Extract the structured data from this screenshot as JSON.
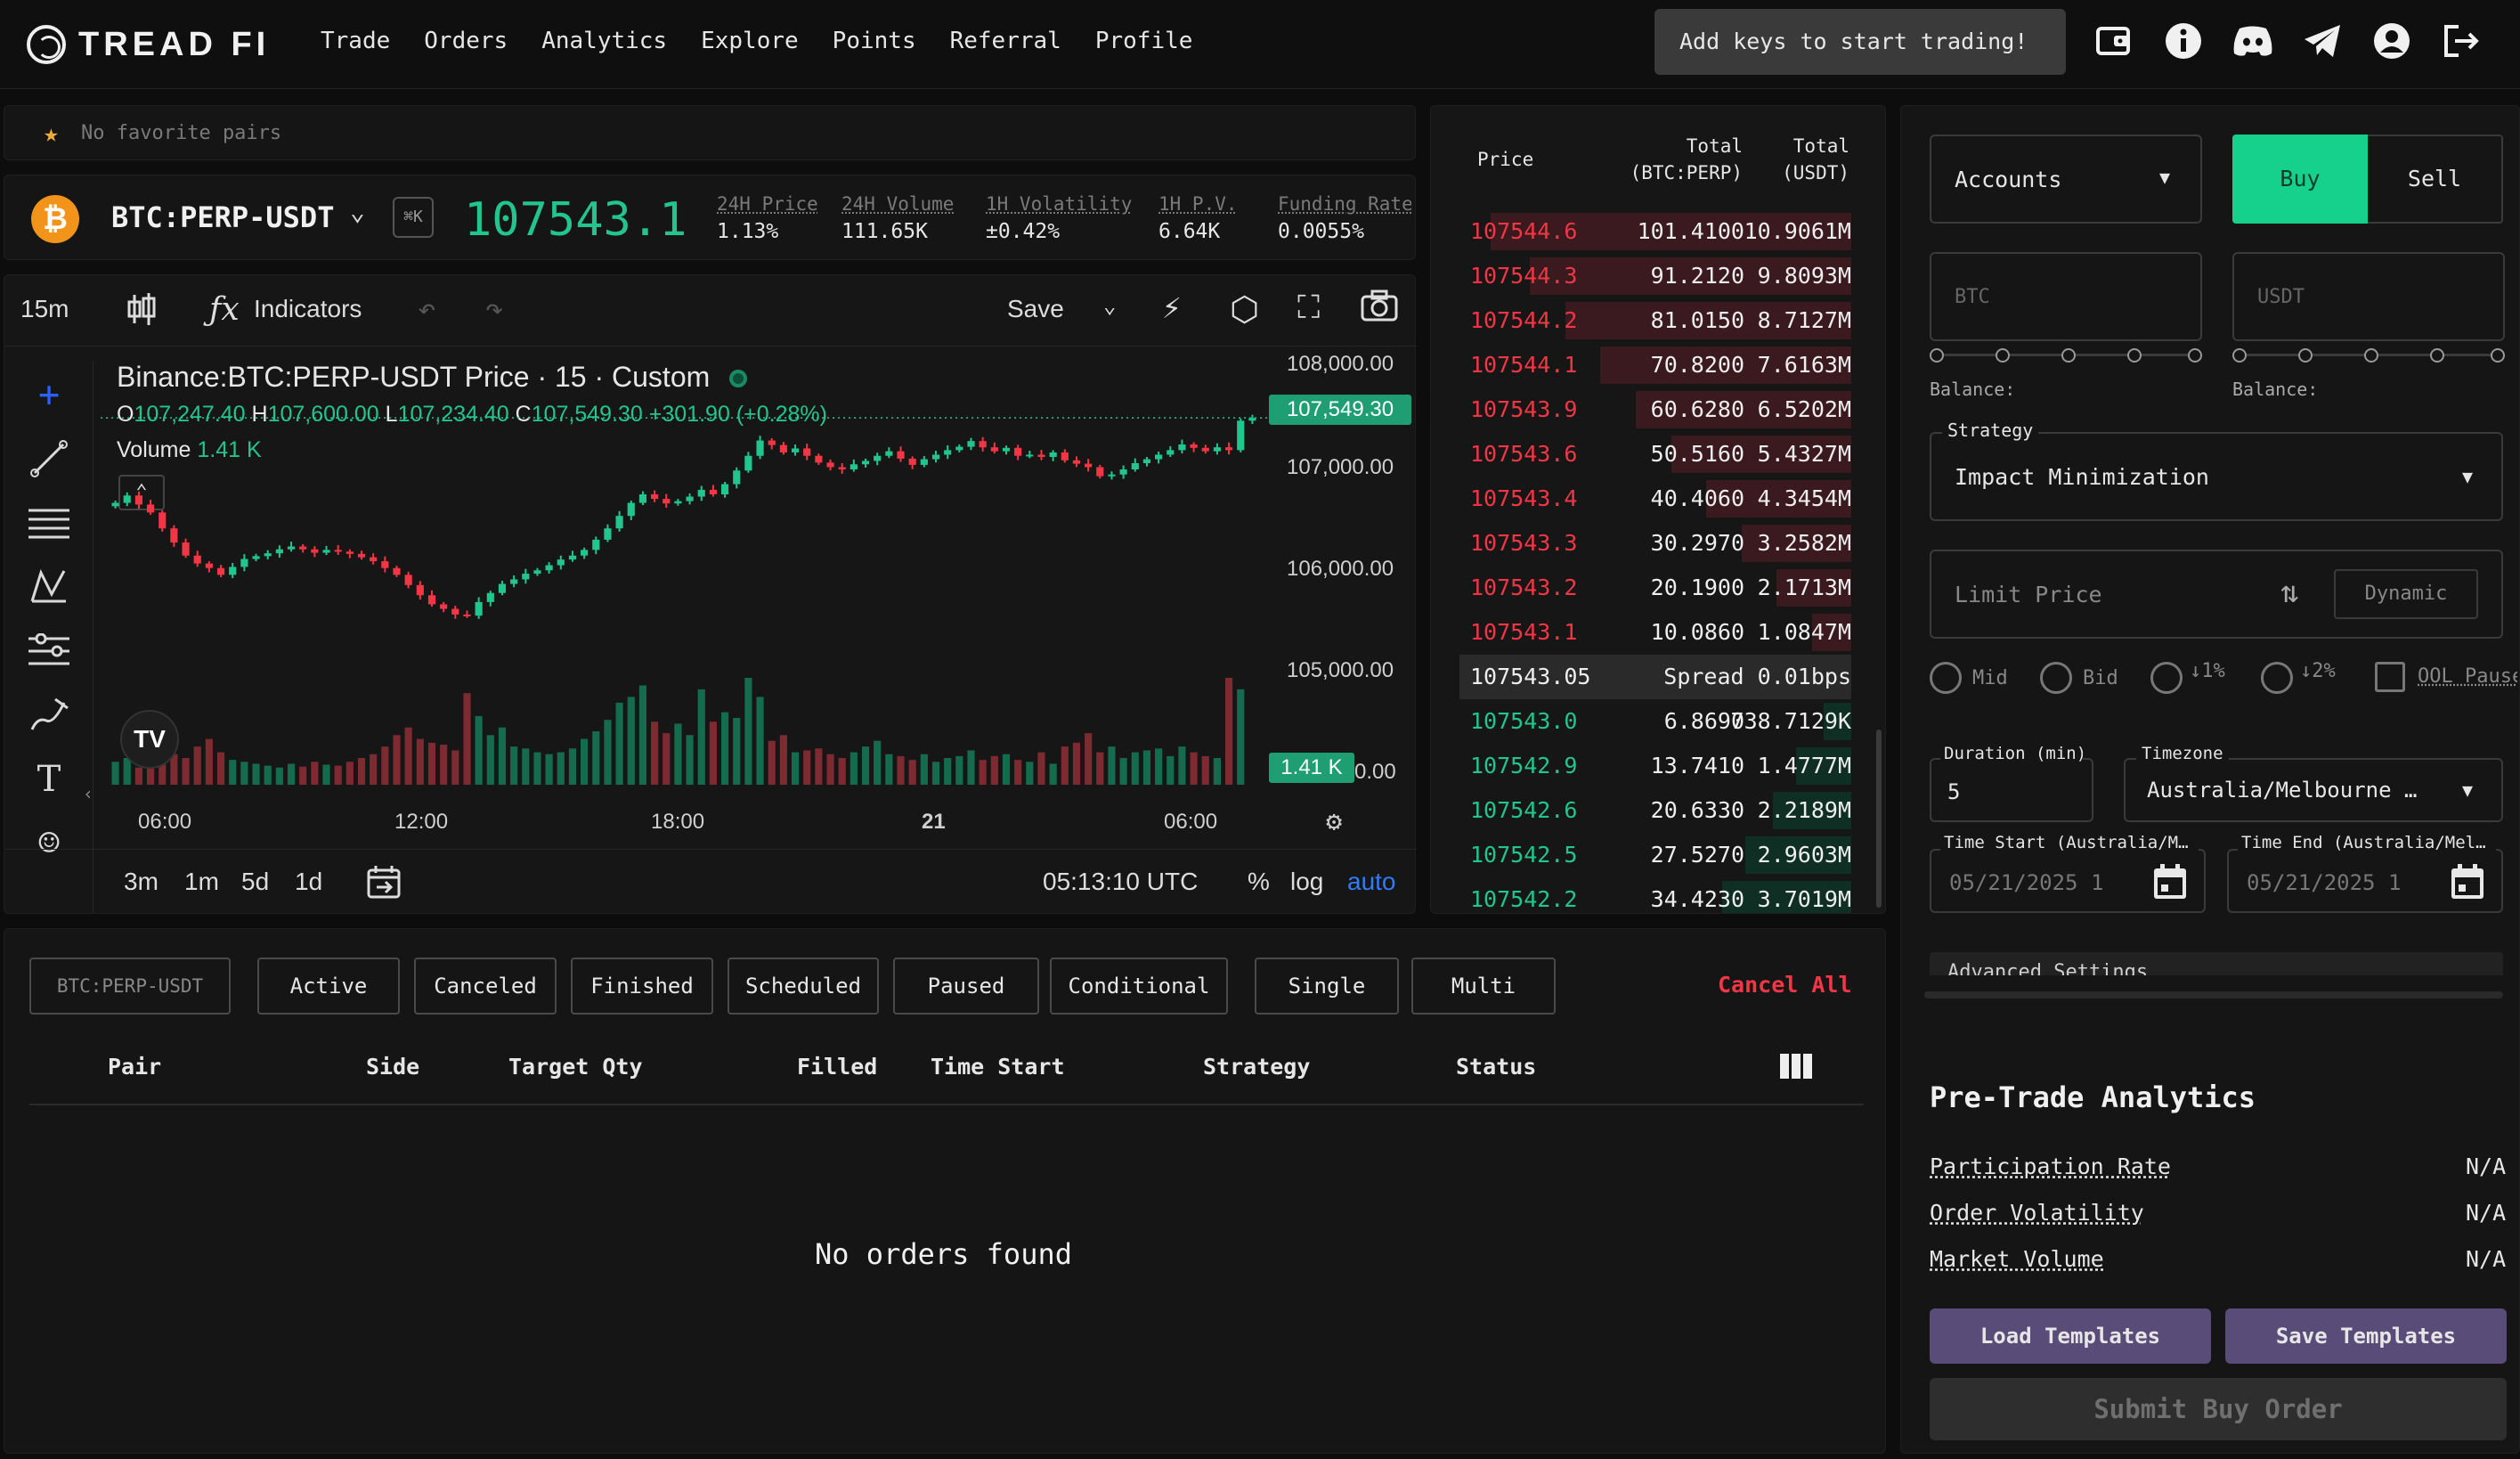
{
  "brand": {
    "name": "TREAD FI"
  },
  "nav": {
    "links": [
      "Trade",
      "Orders",
      "Analytics",
      "Explore",
      "Points",
      "Referral",
      "Profile"
    ]
  },
  "tooltip": "Add keys to start trading!",
  "icons": [
    "wallet-icon",
    "info-icon",
    "discord-icon",
    "telegram-icon",
    "account-icon",
    "logout-icon"
  ],
  "favorites": {
    "text": "No favorite pairs"
  },
  "ticker": {
    "pair": "BTC:PERP-USDT",
    "shortcut": "⌘K",
    "last_price": "107543.1",
    "stats": [
      {
        "label": "24H Price",
        "value": "1.13%",
        "color": "#22c58e"
      },
      {
        "label": "24H Volume",
        "value": "111.65K",
        "color": "#e6e6e6"
      },
      {
        "label": "1H Volatility",
        "value": "±0.42%",
        "color": "#e6e6e6"
      },
      {
        "label": "1H P.V.",
        "value": "6.64K",
        "color": "#e6e6e6"
      },
      {
        "label": "Funding Rate",
        "value": "0.0055%",
        "color": "#22c58e"
      }
    ]
  },
  "chart": {
    "interval": "15m",
    "indicators_label": "Indicators",
    "save_label": "Save",
    "title": "Binance:BTC:PERP-USDT Price · 15 · Custom",
    "ohlc": {
      "o": "107,247.40",
      "h": "107,600.00",
      "l": "107,234.40",
      "c": "107,549.30",
      "chg": "+301.90 (+0.28%)"
    },
    "volume_label": "Volume",
    "volume_value": "1.41 K",
    "price_tag": "107,549.30",
    "volume_tag": "1.41 K",
    "y_ticks": [
      "108,000.00",
      "107,000.00",
      "106,000.00",
      "105,000.00",
      "0.00"
    ],
    "x_ticks": [
      "06:00",
      "12:00",
      "18:00",
      "21",
      "06:00"
    ],
    "ranges": [
      "3m",
      "1m",
      "5d",
      "1d"
    ],
    "clock": "05:13:10 UTC",
    "pct": "%",
    "log": "log",
    "auto": "auto"
  },
  "chart_data": {
    "type": "candlestick",
    "ylim": [
      104000,
      108400
    ],
    "closes": [
      106050,
      106180,
      106020,
      105880,
      105600,
      105350,
      105120,
      104980,
      104900,
      104780,
      104920,
      105060,
      105110,
      105160,
      105230,
      105280,
      105230,
      105170,
      105220,
      105190,
      105150,
      105090,
      105020,
      104900,
      104780,
      104600,
      104420,
      104260,
      104180,
      104080,
      104060,
      104300,
      104460,
      104620,
      104700,
      104800,
      104860,
      104950,
      105050,
      105120,
      105220,
      105400,
      105600,
      105820,
      106050,
      106200,
      106120,
      106040,
      106080,
      106160,
      106280,
      106200,
      106380,
      106620,
      106880,
      107150,
      107070,
      106940,
      107010,
      106880,
      106760,
      106680,
      106640,
      106730,
      106790,
      106880,
      106960,
      106830,
      106720,
      106820,
      106900,
      106980,
      107040,
      107140,
      107030,
      106960,
      107020,
      106880,
      106900,
      106860,
      106940,
      106800,
      106740,
      106680,
      106520,
      106550,
      106640,
      106750,
      106820,
      106900,
      106980,
      107080,
      107020,
      106960,
      107030,
      106980,
      107500,
      107549
    ],
    "volumes": [
      120,
      140,
      90,
      110,
      180,
      160,
      140,
      200,
      240,
      170,
      130,
      120,
      110,
      100,
      90,
      110,
      95,
      120,
      105,
      100,
      120,
      140,
      160,
      200,
      260,
      300,
      240,
      220,
      210,
      180,
      480,
      360,
      260,
      300,
      200,
      190,
      170,
      160,
      170,
      190,
      240,
      280,
      340,
      430,
      460,
      520,
      330,
      270,
      320,
      260,
      500,
      330,
      380,
      350,
      560,
      460,
      230,
      260,
      170,
      180,
      190,
      160,
      140,
      170,
      200,
      230,
      160,
      150,
      130,
      160,
      120,
      140,
      150,
      180,
      130,
      150,
      160,
      130,
      120,
      170,
      110,
      200,
      220,
      270,
      170,
      200,
      140,
      170,
      180,
      190,
      150,
      200,
      170,
      150,
      140,
      560,
      500
    ]
  },
  "orderbook": {
    "headers": {
      "price": "Price",
      "total_base": "Total\n(BTC:PERP)",
      "total_quote": "Total\n(USDT)"
    },
    "asks": [
      {
        "price": "107544.6",
        "amount": "101.4100",
        "total": "10.9061M",
        "depth": 0.92
      },
      {
        "price": "107544.3",
        "amount": "91.2120",
        "total": "9.8093M",
        "depth": 0.82
      },
      {
        "price": "107544.2",
        "amount": "81.0150",
        "total": "8.7127M",
        "depth": 0.73
      },
      {
        "price": "107544.1",
        "amount": "70.8200",
        "total": "7.6163M",
        "depth": 0.64
      },
      {
        "price": "107543.9",
        "amount": "60.6280",
        "total": "6.5202M",
        "depth": 0.55
      },
      {
        "price": "107543.6",
        "amount": "50.5160",
        "total": "5.4327M",
        "depth": 0.46
      },
      {
        "price": "107543.4",
        "amount": "40.4060",
        "total": "4.3454M",
        "depth": 0.37
      },
      {
        "price": "107543.3",
        "amount": "30.2970",
        "total": "3.2582M",
        "depth": 0.28
      },
      {
        "price": "107543.2",
        "amount": "20.1900",
        "total": "2.1713M",
        "depth": 0.19
      },
      {
        "price": "107543.1",
        "amount": "10.0860",
        "total": "1.0847M",
        "depth": 0.1
      }
    ],
    "spread": {
      "price": "107543.05",
      "label": "Spread 0.01bps"
    },
    "bids": [
      {
        "price": "107543.0",
        "amount": "6.8690",
        "total": "738.7129K",
        "depth": 0.07
      },
      {
        "price": "107542.9",
        "amount": "13.7410",
        "total": "1.4777M",
        "depth": 0.14
      },
      {
        "price": "107542.6",
        "amount": "20.6330",
        "total": "2.2189M",
        "depth": 0.2
      },
      {
        "price": "107542.5",
        "amount": "27.5270",
        "total": "2.9603M",
        "depth": 0.27
      },
      {
        "price": "107542.2",
        "amount": "34.4230",
        "total": "3.7019M",
        "depth": 0.33
      }
    ]
  },
  "orders": {
    "filters": [
      "BTC:PERP-USDT",
      "Active",
      "Canceled",
      "Finished",
      "Scheduled",
      "Paused",
      "Conditional",
      "Single",
      "Multi"
    ],
    "cancel_all": "Cancel All",
    "columns": [
      "Pair",
      "Side",
      "Target Qty",
      "Filled",
      "Time Start",
      "Strategy",
      "Status"
    ],
    "empty": "No orders found"
  },
  "form": {
    "accounts": "Accounts",
    "buy": "Buy",
    "sell": "Sell",
    "base_placeholder": "BTC",
    "quote_placeholder": "USDT",
    "balance_label": "Balance:",
    "strategy_label": "Strategy",
    "strategy_value": "Impact Minimization",
    "limit_placeholder": "Limit Price",
    "dynamic": "Dynamic",
    "radios": [
      "Mid",
      "Bid",
      "↓1%",
      "↓2%"
    ],
    "ool": "OOL Pause",
    "duration_label": "Duration (min)",
    "duration_value": "5",
    "timezone_label": "Timezone",
    "timezone_value": "Australia/Melbourne …",
    "time_start_label": "Time Start (Australia/M…",
    "time_start_value": "05/21/2025 1",
    "time_end_label": "Time End (Australia/Mel…",
    "time_end_value": "05/21/2025 1",
    "advanced": "Advanced Settings",
    "analytics_title": "Pre-Trade Analytics",
    "analytics": [
      {
        "label": "Participation Rate",
        "value": "N/A"
      },
      {
        "label": "Order Volatility",
        "value": "N/A"
      },
      {
        "label": "Market Volume",
        "value": "N/A"
      }
    ],
    "load_templates": "Load Templates",
    "save_templates": "Save Templates",
    "submit": "Submit Buy Order"
  },
  "colors": {
    "accent": "#22c58e",
    "down": "#f23645",
    "buy_btn": "#16d18c",
    "template_btn": "#5a4c78"
  }
}
